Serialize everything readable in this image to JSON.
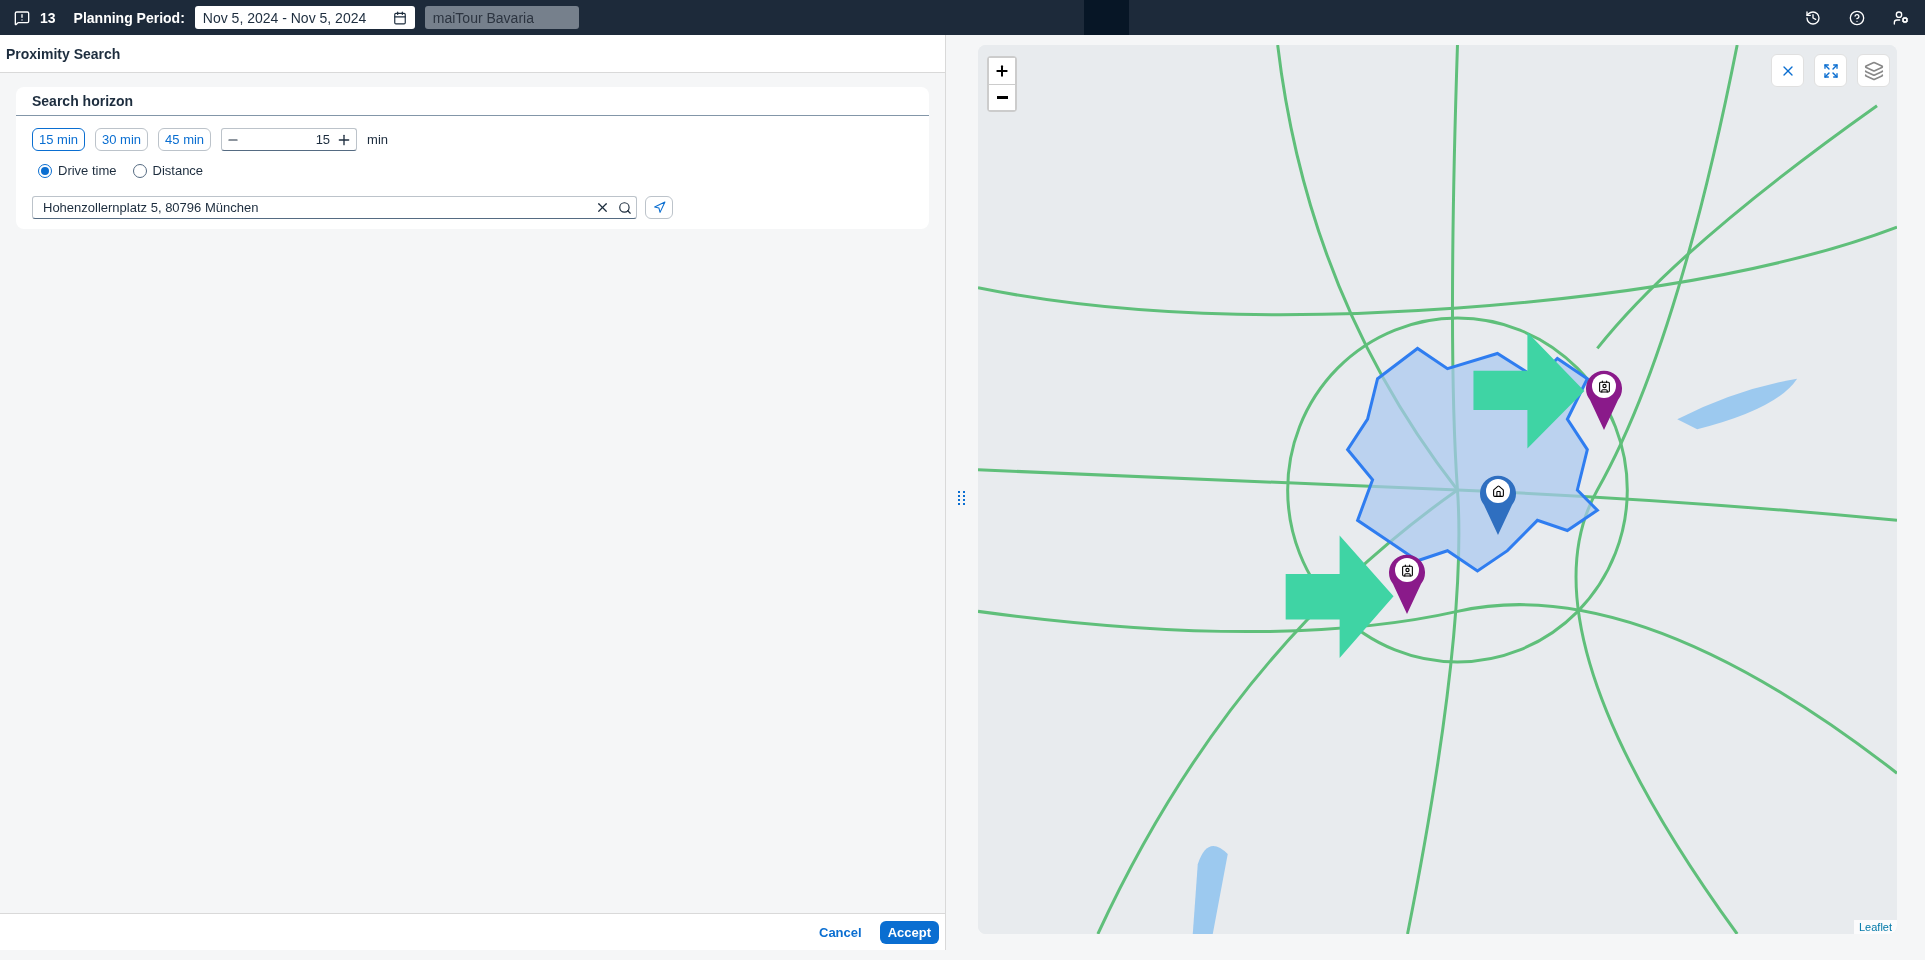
{
  "header": {
    "notification_count": "13",
    "planning_period_label": "Planning Period:",
    "planning_period": "Nov 5, 2024 - Nov 5, 2024",
    "tour": "maiTour Bavaria"
  },
  "panel": {
    "title": "Proximity Search"
  },
  "search_horizon": {
    "title": "Search horizon",
    "presets": [
      {
        "label": "15 min",
        "selected": true
      },
      {
        "label": "30 min",
        "selected": false
      },
      {
        "label": "45 min",
        "selected": false
      }
    ],
    "stepper": {
      "value": "15",
      "unit": "min"
    },
    "modes": [
      {
        "label": "Drive time",
        "selected": true
      },
      {
        "label": "Distance",
        "selected": false
      }
    ],
    "address": {
      "value": "Hohenzollernplatz 5, 80796 München"
    }
  },
  "map": {
    "attribution": "Leaflet",
    "markers": [
      {
        "kind": "home"
      },
      {
        "kind": "person"
      },
      {
        "kind": "person"
      }
    ]
  },
  "footer": {
    "buttons": [
      {
        "label": "Cancel",
        "kind": "secondary"
      },
      {
        "label": "Accept",
        "kind": "primary"
      }
    ]
  }
}
